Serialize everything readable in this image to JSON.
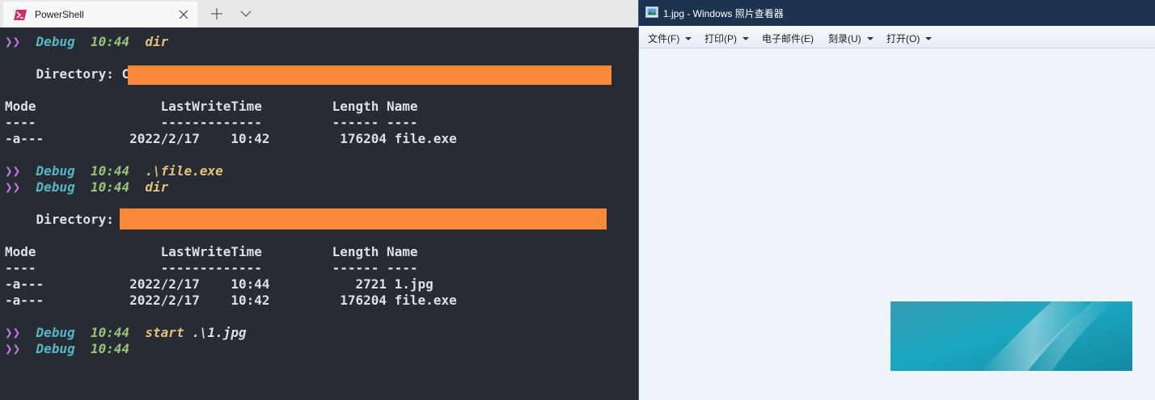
{
  "terminal": {
    "tab_title": "PowerShell",
    "icons": {
      "tab_icon": "powershell-icon",
      "close": "close-icon",
      "new_tab": "plus-icon",
      "dropdown": "chevron-down-icon"
    },
    "prompt": {
      "arrow": "❯❯",
      "env": "Debug",
      "time": "10:44"
    },
    "block1": {
      "command": "dir",
      "directory_label": "Directory:",
      "directory_prefix": "C",
      "header": "Mode                LastWriteTime         Length Name",
      "separator": "----                -------------         ------ ----",
      "rows": [
        "-a---           2022/2/17    10:42         176204 file.exe"
      ]
    },
    "run_command": ".\\file.exe",
    "block2": {
      "command": "dir",
      "directory_label": "Directory:",
      "header": "Mode                LastWriteTime         Length Name",
      "separator": "----                -------------         ------ ----",
      "rows": [
        "-a---           2022/2/17    10:44           2721 1.jpg",
        "-a---           2022/2/17    10:42         176204 file.exe"
      ]
    },
    "start_command": "start",
    "start_arg": ".\\1.jpg",
    "colors": {
      "background": "#272b34",
      "redaction": "#f78939",
      "arrow": "#c678dd",
      "env": "#56b6c2",
      "time": "#98c379",
      "command": "#e5c07b"
    }
  },
  "viewer": {
    "title": "1.jpg - Windows 照片查看器",
    "icon": "photo-viewer-icon",
    "menu": [
      {
        "label": "文件(F)",
        "has_dropdown": true
      },
      {
        "label": "打印(P)",
        "has_dropdown": true
      },
      {
        "label": "电子邮件(E)",
        "has_dropdown": false
      },
      {
        "label": "刻录(U)",
        "has_dropdown": true
      },
      {
        "label": "打开(O)",
        "has_dropdown": true
      }
    ],
    "colors": {
      "titlebar": "#1c3450",
      "canvas": "#eef2f9",
      "photo": "#2aa6bf"
    }
  }
}
